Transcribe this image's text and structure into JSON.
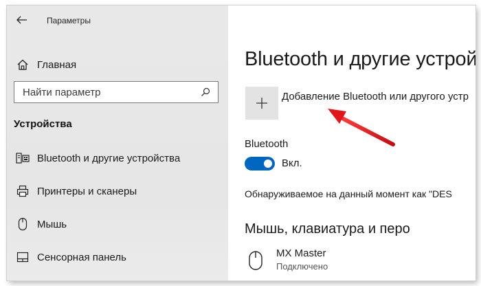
{
  "window": {
    "title": "Параметры",
    "back_icon": "arrow-left-icon"
  },
  "sidebar": {
    "home": {
      "label": "Главная",
      "icon": "home-icon"
    },
    "search": {
      "placeholder": "Найти параметр",
      "icon": "search-icon"
    },
    "section_title": "Устройства",
    "items": [
      {
        "label": "Bluetooth и другие устройства",
        "icon": "devices-icon"
      },
      {
        "label": "Принтеры и сканеры",
        "icon": "printer-icon"
      },
      {
        "label": "Мышь",
        "icon": "mouse-icon"
      },
      {
        "label": "Сенсорная панель",
        "icon": "touchpad-icon"
      }
    ]
  },
  "main": {
    "title": "Bluetooth и другие устрой",
    "add_device": {
      "label": "Добавление Bluetooth или другого устр",
      "icon": "plus-icon"
    },
    "bluetooth": {
      "label": "Bluetooth",
      "state": "Вкл.",
      "enabled": true
    },
    "discoverable_text": "Обнаруживаемое на данный момент как \"DES",
    "section_mouse": "Мышь, клавиатура и перо",
    "devices": [
      {
        "name": "MX Master",
        "status": "Подключено",
        "icon": "mouse-icon"
      }
    ]
  },
  "colors": {
    "accent": "#0067c0",
    "sidebar_bg": "#e6e6e6",
    "annotation_arrow": "#e0161b"
  }
}
